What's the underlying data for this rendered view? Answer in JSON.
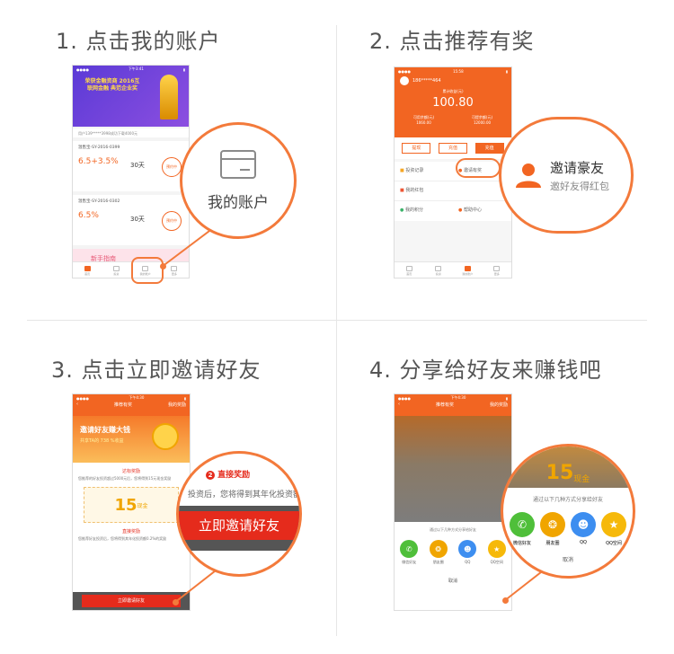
{
  "steps": [
    {
      "title": "1. 点击我的账户"
    },
    {
      "title": "2. 点击推荐有奖"
    },
    {
      "title": "3. 点击立即邀请好友"
    },
    {
      "title": "4. 分享给好友来赚钱吧"
    }
  ],
  "step1": {
    "banner": "荣获金融资商 2016互联网金融 典范企业奖",
    "notice": "用户139*****3998成功下载4000元",
    "products": [
      {
        "name": "温售宝-SY-2016-0399",
        "rate": "6.5+3.5%",
        "days": "30天",
        "badge": "预约中"
      },
      {
        "name": "温售宝-SY-2016-0302",
        "rate": "6.5%",
        "days": "30天",
        "badge": "预约中"
      }
    ],
    "guide": "新手指南",
    "tabs": [
      "首页",
      "投资",
      "我的账户",
      "更多"
    ],
    "zoom_label": "我的账户"
  },
  "step2": {
    "phone": "186*****464",
    "balance_label": "累计收益(元)",
    "balance": "100.80",
    "sub1_label": "可用余额(元)",
    "sub1": "1060.00",
    "sub2_label": "可提余额(元)",
    "sub2": "12000.00",
    "actions": [
      "提现",
      "充值",
      "充值"
    ],
    "menu": [
      "投资记录",
      "邀请有奖",
      "我的红包",
      "",
      "我的积分",
      "帮助中心"
    ],
    "tabs": [
      "首页",
      "投资",
      "我的账户",
      "更多"
    ],
    "zoom_title": "邀请豪友",
    "zoom_sub": "邀好友得红包"
  },
  "step3": {
    "nav_title": "推荐有奖",
    "nav_right": "我的奖励",
    "banner": "邀请好友赚大钱",
    "banner_sub": "共享TA的 738 %收益",
    "section1": "达标奖励",
    "section1_text": "您推荐的好友投资超过5000元后，您将得到15元现金奖励",
    "coupon_amount": "15",
    "coupon_unit": "现金",
    "section2": "直接奖励",
    "section2_text": "您推荐好友投资后，您将得到其年化投资额0.2%的奖励",
    "invite_button": "立即邀请好友",
    "zoom_section": "直接奖励",
    "zoom_text": "投资后，您将得到其年化投资额0",
    "zoom_button": "立即邀请好友"
  },
  "step4": {
    "nav_title": "推荐有奖",
    "nav_right": "我的奖励",
    "share_prompt": "通过以下几种方式分享给好友",
    "share": [
      {
        "label": "微信好友",
        "color": "#4fbf3a"
      },
      {
        "label": "朋友圈",
        "color": "#f0a500"
      },
      {
        "label": "QQ",
        "color": "#3d8ef0"
      },
      {
        "label": "QQ空间",
        "color": "#f6b90a"
      }
    ],
    "cancel": "取消",
    "zoom_coupon": "15",
    "zoom_coupon_unit": "现金"
  }
}
